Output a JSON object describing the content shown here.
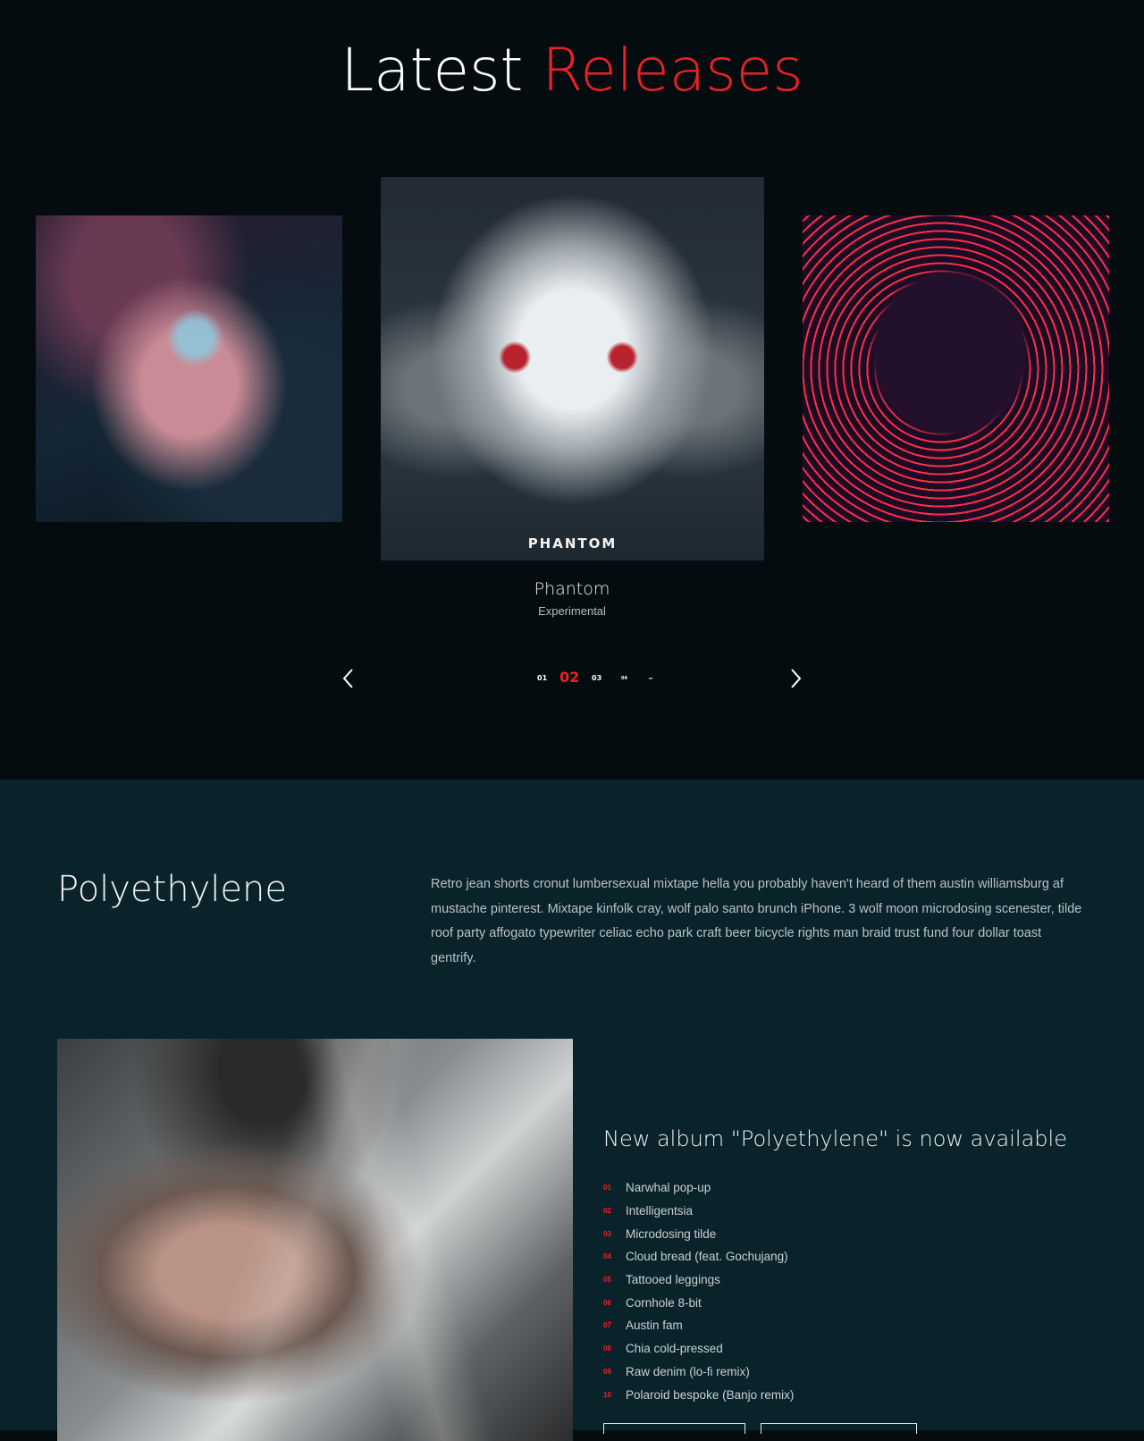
{
  "header": {
    "title_white": "Latest",
    "title_red": "Releases"
  },
  "carousel": {
    "cover_center_label": "PHANTOM",
    "current_title": "Phantom",
    "current_genre": "Experimental",
    "pages": [
      "01",
      "02",
      "03",
      "04",
      "05"
    ],
    "active_page": "02"
  },
  "album": {
    "name": "Polyethylene",
    "description": "Retro jean shorts cronut lumbersexual mixtape hella you probably haven't heard of them austin williamsburg af mustache pinterest. Mixtape kinfolk cray, wolf palo santo brunch iPhone. 3 wolf moon microdosing scenester, tilde roof party affogato typewriter celiac echo park craft beer bicycle rights man braid trust fund four dollar toast gentrify.",
    "announcement": "New album \"Polyethylene\" is now available",
    "tracks": [
      {
        "num": "01",
        "title": "Narwhal pop-up"
      },
      {
        "num": "02",
        "title": "Intelligentsia"
      },
      {
        "num": "03",
        "title": "Microdosing tilde"
      },
      {
        "num": "04",
        "title": "Cloud bread (feat. Gochujang)"
      },
      {
        "num": "05",
        "title": "Tattooed leggings"
      },
      {
        "num": "06",
        "title": "Cornhole 8-bit"
      },
      {
        "num": "07",
        "title": "Austin fam"
      },
      {
        "num": "08",
        "title": "Chia cold-pressed"
      },
      {
        "num": "09",
        "title": "Raw denim (lo-fi remix)"
      },
      {
        "num": "10",
        "title": "Polaroid bespoke (Banjo remix)"
      }
    ]
  },
  "colors": {
    "accent": "#ec2027",
    "top_bg": "#050c10",
    "bottom_bg": "#0a232a"
  },
  "icons": {
    "prev": "chevron-left-icon",
    "next": "chevron-right-icon"
  }
}
